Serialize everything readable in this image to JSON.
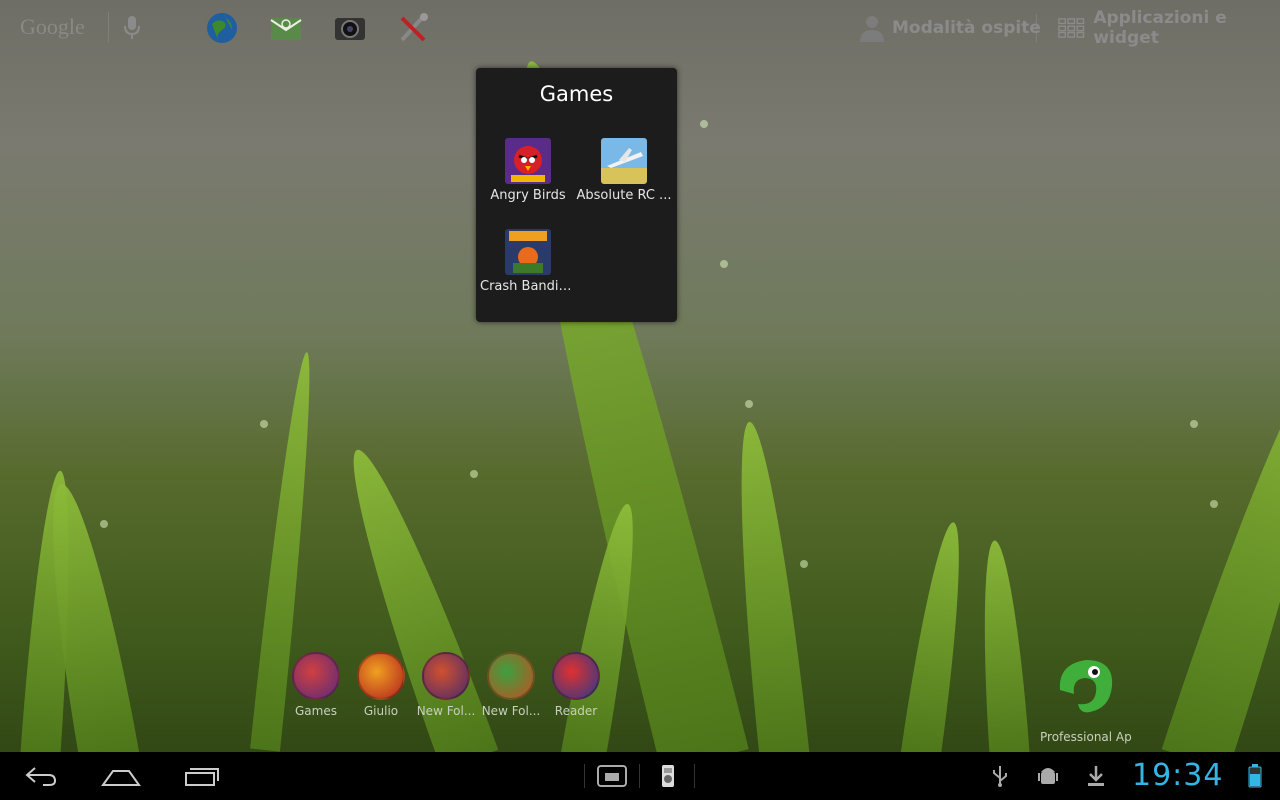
{
  "top_bar": {
    "search_label": "Google",
    "guest_label": "Modalità ospite",
    "apps_label": "Applicazioni e widget",
    "icons": [
      "browser-icon",
      "email-icon",
      "camera-icon",
      "settings-icon"
    ]
  },
  "folder": {
    "title": "Games",
    "items": [
      {
        "label": "Angry Birds",
        "icon": "angry-birds-icon"
      },
      {
        "label": "Absolute RC ...",
        "icon": "absolute-rc-icon"
      },
      {
        "label": "Crash Bandic...",
        "icon": "crash-bandicoot-icon"
      }
    ]
  },
  "dock": {
    "shortcuts": [
      {
        "label": "Games",
        "color": "#c0392b"
      },
      {
        "label": "Giulio",
        "color": "#d35400"
      },
      {
        "label": "New Fol...",
        "color": "#7d3c98"
      },
      {
        "label": "New Fol...",
        "color": "#27ae60"
      },
      {
        "label": "Reader",
        "color": "#c0392b"
      }
    ],
    "pro_label": "Professional Ap"
  },
  "status_bar": {
    "clock": "19:34"
  },
  "colors": {
    "accent": "#33b5e5"
  }
}
